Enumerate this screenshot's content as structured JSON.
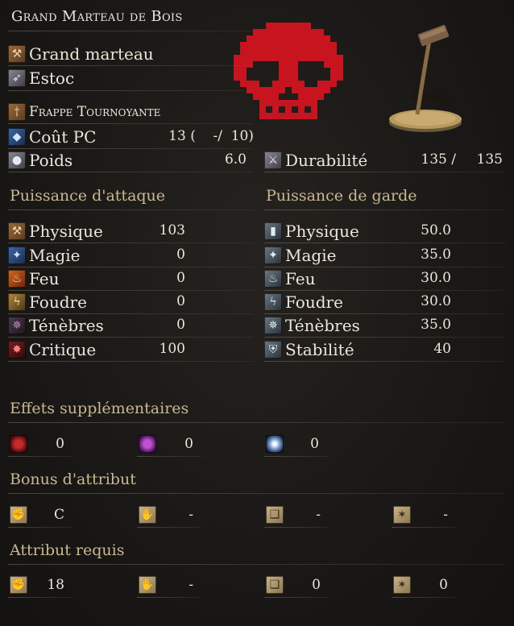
{
  "title": "Grand Marteau de Bois",
  "weapon": {
    "type": "Grand marteau",
    "attack_type": "Estoc",
    "skill": "Frappe Tournoyante",
    "fp_label": "Coût PC",
    "fp_value": "13 (    -/  10)",
    "weight_label": "Poids",
    "weight_value": "6.0",
    "durability_label": "Durabilité",
    "durability_current": "135 /",
    "durability_max": "135"
  },
  "attack": {
    "header": "Puissance d'attaque",
    "rows": [
      {
        "label": "Physique",
        "value": "103"
      },
      {
        "label": "Magie",
        "value": "0"
      },
      {
        "label": "Feu",
        "value": "0"
      },
      {
        "label": "Foudre",
        "value": "0"
      },
      {
        "label": "Ténèbres",
        "value": "0"
      },
      {
        "label": "Critique",
        "value": "100"
      }
    ]
  },
  "guard": {
    "header": "Puissance de garde",
    "rows": [
      {
        "label": "Physique",
        "value": "50.0"
      },
      {
        "label": "Magie",
        "value": "35.0"
      },
      {
        "label": "Feu",
        "value": "30.0"
      },
      {
        "label": "Foudre",
        "value": "30.0"
      },
      {
        "label": "Ténèbres",
        "value": "35.0"
      },
      {
        "label": "Stabilité",
        "value": "40"
      }
    ]
  },
  "effects": {
    "header": "Effets supplémentaires",
    "values": [
      "0",
      "0",
      "0"
    ]
  },
  "scaling": {
    "header": "Bonus d'attribut",
    "values": [
      "C",
      "-",
      "-",
      "-"
    ]
  },
  "requirements": {
    "header": "Attribut requis",
    "values": [
      "18",
      "-",
      "0",
      "0"
    ]
  },
  "colors": {
    "skull": "#c8141e",
    "header": "#c9b890",
    "text": "#ece6da"
  }
}
